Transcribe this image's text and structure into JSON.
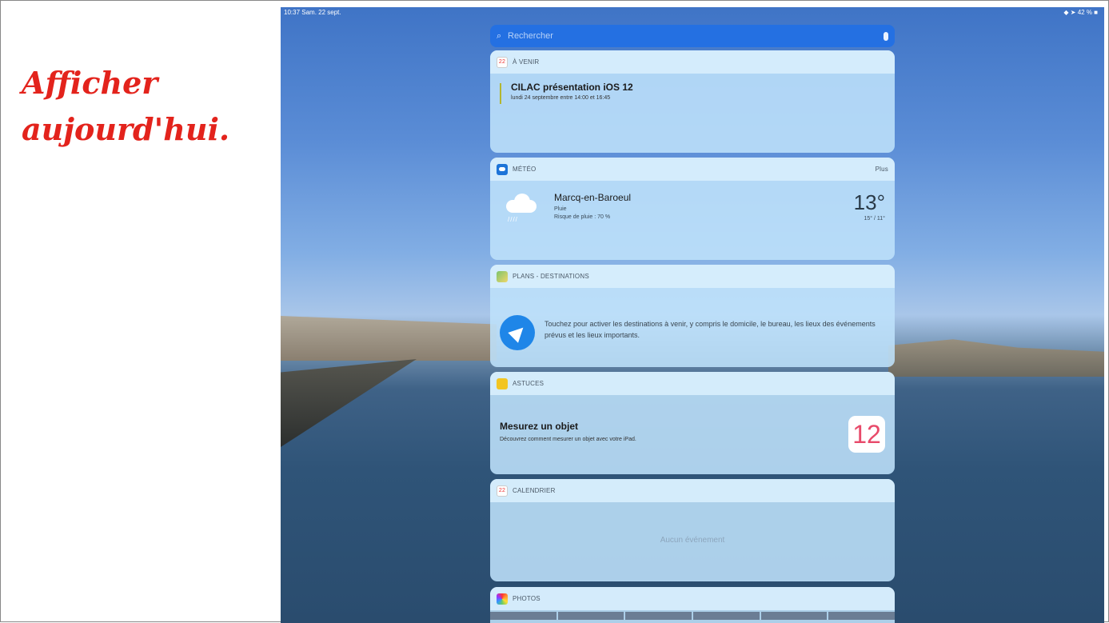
{
  "slide": {
    "title_line1": "Afficher",
    "title_line2": "aujourd'hui."
  },
  "status": {
    "left": "10:37  Sam. 22 sept.",
    "right": "◆ ➤ 42 % ■"
  },
  "search": {
    "placeholder": "Rechercher"
  },
  "widgets": {
    "avenir": {
      "header": "À VENIR",
      "icon_day": "22",
      "event_title": "CILAC présentation iOS 12",
      "event_time": "lundi 24 septembre entre 14:00 et 16:45"
    },
    "meteo": {
      "header": "MÉTÉO",
      "more": "Plus",
      "city": "Marcq-en-Baroeul",
      "condition": "Pluie",
      "rain_risk": "Risque de pluie : 70 %",
      "temperature": "13°",
      "range": "15° / 11°"
    },
    "plans": {
      "header": "PLANS - DESTINATIONS",
      "text": "Touchez pour activer les destinations à venir, y compris le domicile, le bureau, les lieux des événements prévus et les lieux importants."
    },
    "astuces": {
      "header": "ASTUCES",
      "title": "Mesurez un objet",
      "subtitle": "Découvrez comment mesurer un objet avec votre iPad.",
      "badge": "12"
    },
    "calendrier": {
      "header": "CALENDRIER",
      "icon_day": "22",
      "empty": "Aucun événement"
    },
    "photos": {
      "header": "PHOTOS"
    }
  },
  "icons": [
    "search-icon",
    "microphone-icon",
    "calendar-icon",
    "weather-icon",
    "rain-cloud-icon",
    "maps-icon",
    "location-arrow-icon",
    "tips-icon",
    "photos-icon"
  ]
}
